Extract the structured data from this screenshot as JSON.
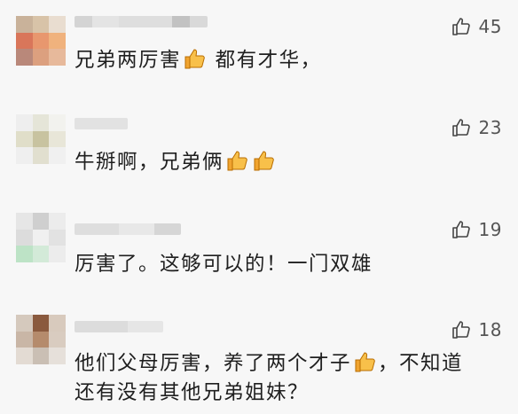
{
  "colors": {
    "background": "#f7f7f7",
    "text": "#1f1f1f",
    "like_count": "#555555",
    "emoji_yellow": "#f6b93b"
  },
  "comments": [
    {
      "avatar_icon": "blurred-avatar",
      "like_icon": "thumbs-up-outline-icon",
      "likes": "45",
      "parts": [
        "兄弟两厉害",
        "都有才华，"
      ],
      "emoji_icon": "thumbs-up-emoji-icon"
    },
    {
      "avatar_icon": "blurred-avatar",
      "like_icon": "thumbs-up-outline-icon",
      "likes": "23",
      "parts": [
        "牛掰啊，兄弟俩"
      ],
      "emoji_icon": "thumbs-up-emoji-icon"
    },
    {
      "avatar_icon": "blurred-avatar",
      "like_icon": "thumbs-up-outline-icon",
      "likes": "19",
      "parts": [
        "厉害了。这够可以的！一门双雄"
      ]
    },
    {
      "avatar_icon": "blurred-avatar",
      "like_icon": "thumbs-up-outline-icon",
      "likes": "18",
      "parts": [
        "他们父母厉害，养了两个才子",
        "，不知道",
        "还有没有其他兄弟姐妹？"
      ],
      "emoji_icon": "thumbs-up-emoji-icon"
    }
  ]
}
